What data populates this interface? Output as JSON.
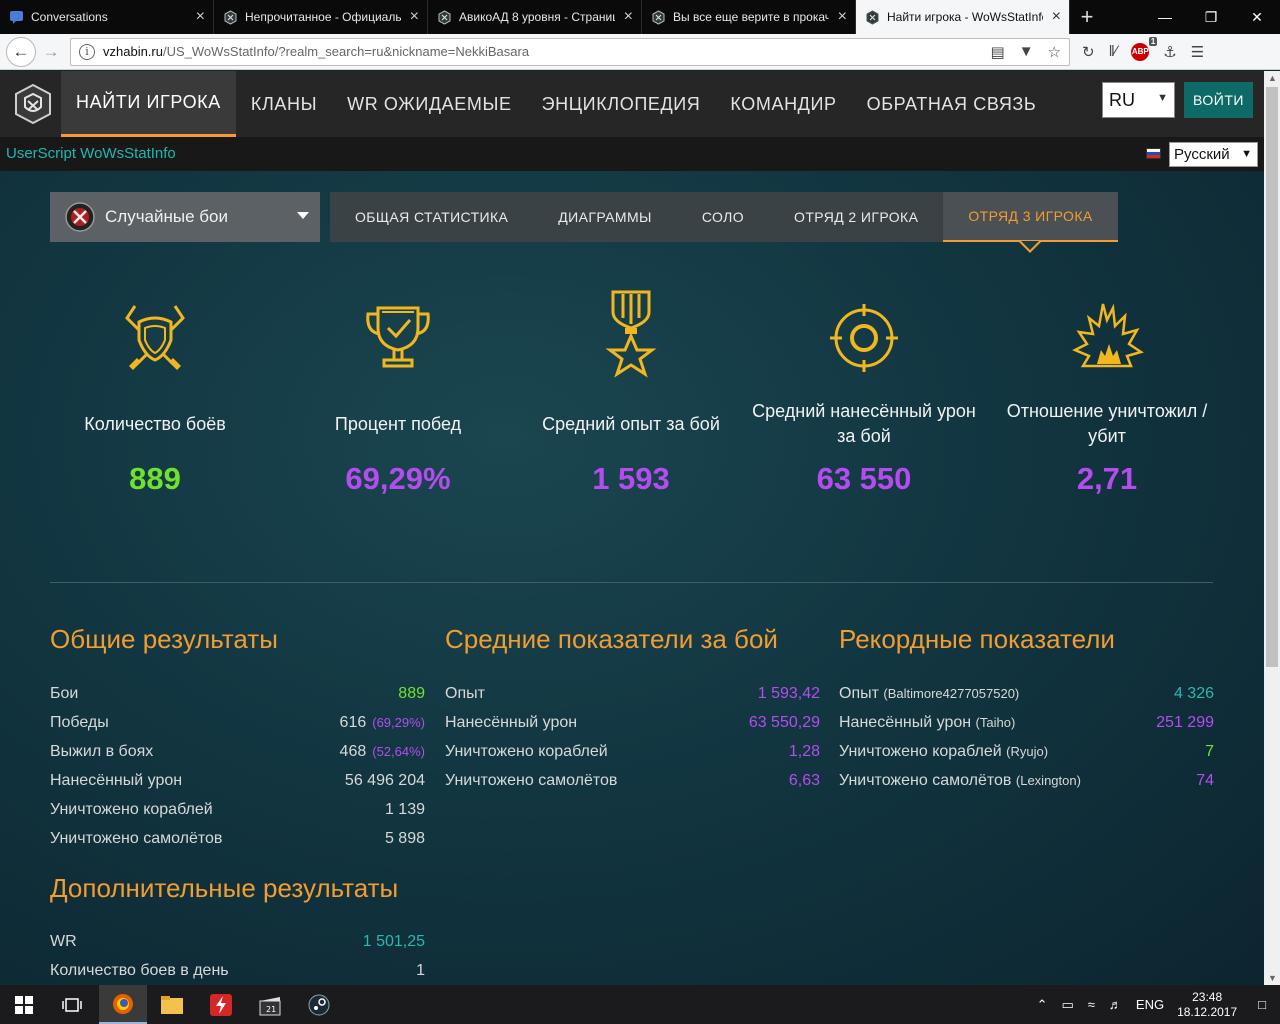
{
  "browser": {
    "tabs": [
      {
        "title": "Conversations",
        "active": false
      },
      {
        "title": "Непрочитанное - Официальный",
        "active": false
      },
      {
        "title": "АвикоАД 8 уровня - Страница",
        "active": false
      },
      {
        "title": "Вы все еще верите в прокачку",
        "active": false
      },
      {
        "title": "Найти игрока - WoWsStatInfo",
        "active": true
      }
    ],
    "url_host": "vzhabin.ru",
    "url_path": "/US_WoWsStatInfo/?realm_search=ru&nickname=NekkiBasara",
    "abp_badge": "1"
  },
  "site": {
    "nav": [
      "НАЙТИ ИГРОКА",
      "КЛАНЫ",
      "WR ОЖИДАЕМЫЕ",
      "ЭНЦИКЛОПЕДИЯ",
      "КОМАНДИР",
      "ОБРАТНАЯ СВЯЗЬ"
    ],
    "realm_value": "RU",
    "login_label": "ВОЙТИ",
    "userscript_label": "UserScript WoWsStatInfo",
    "language_value": "Русский",
    "battle_type": "Случайные бои",
    "stat_tabs": [
      "ОБЩАЯ СТАТИСТИКА",
      "ДИАГРАММЫ",
      "СОЛО",
      "ОТРЯД 2 ИГРОКА",
      "ОТРЯД 3 ИГРОКА"
    ],
    "active_stat_tab": 4
  },
  "big_stats": [
    {
      "label": "Количество боёв",
      "value": "889",
      "color": "#6ee22d",
      "icon": "crossed-swords-shield-icon"
    },
    {
      "label": "Процент побед",
      "value": "69,29%",
      "color": "#b44cf0",
      "icon": "trophy-icon"
    },
    {
      "label": "Средний опыт за бой",
      "value": "1 593",
      "color": "#b44cf0",
      "icon": "medal-star-icon"
    },
    {
      "label": "Средний нанесённый урон за бой",
      "value": "63 550",
      "color": "#b44cf0",
      "icon": "crosshair-icon"
    },
    {
      "label": "Отношение уничтожил / убит",
      "value": "2,71",
      "color": "#b44cf0",
      "icon": "explosion-icon"
    }
  ],
  "general": {
    "title": "Общие результаты",
    "rows": [
      {
        "label": "Бои",
        "value": "889",
        "pct": "",
        "cls": "green"
      },
      {
        "label": "Победы",
        "value": "616",
        "pct": "(69,29%)",
        "cls": "white"
      },
      {
        "label": "Выжил в боях",
        "value": "468",
        "pct": "(52,64%)",
        "cls": "white"
      },
      {
        "label": "Нанесённый урон",
        "value": "56 496 204",
        "pct": "",
        "cls": "white"
      },
      {
        "label": "Уничтожено кораблей",
        "value": "1 139",
        "pct": "",
        "cls": "white"
      },
      {
        "label": "Уничтожено самолётов",
        "value": "5 898",
        "pct": "",
        "cls": "white"
      }
    ]
  },
  "average": {
    "title": "Средние показатели за бой",
    "rows": [
      {
        "label": "Опыт",
        "value": "1 593,42",
        "cls": "purple"
      },
      {
        "label": "Нанесённый урон",
        "value": "63 550,29",
        "cls": "purple"
      },
      {
        "label": "Уничтожено кораблей",
        "value": "1,28",
        "cls": "purple"
      },
      {
        "label": "Уничтожено самолётов",
        "value": "6,63",
        "cls": "purple"
      }
    ]
  },
  "records": {
    "title": "Рекордные показатели",
    "rows": [
      {
        "label": "Опыт",
        "ship": "(Baltimore4277057520)",
        "value": "4 326",
        "cls": "teal"
      },
      {
        "label": "Нанесённый урон",
        "ship": "(Taiho)",
        "value": "251 299",
        "cls": "purple"
      },
      {
        "label": "Уничтожено кораблей",
        "ship": "(Ryujo)",
        "value": "7",
        "cls": "green"
      },
      {
        "label": "Уничтожено самолётов",
        "ship": "(Lexington)",
        "value": "74",
        "cls": "purple"
      }
    ]
  },
  "extra": {
    "title": "Дополнительные результаты",
    "rows": [
      {
        "label": "WR",
        "value": "1 501,25",
        "cls": "teal"
      },
      {
        "label": "Количество боев в день",
        "value": "1",
        "cls": "white"
      }
    ]
  },
  "taskbar": {
    "lang": "ENG",
    "time": "23:48",
    "date": "18.12.2017"
  },
  "colors": {
    "accent": "#f39c2f",
    "green": "#6ee22d",
    "purple": "#b44cf0",
    "teal": "#2ab7b0"
  }
}
